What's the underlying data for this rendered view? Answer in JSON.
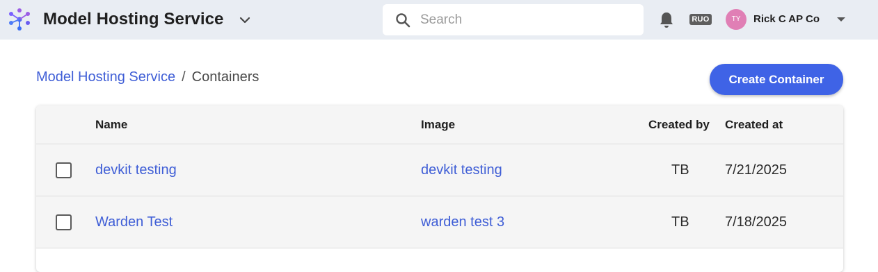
{
  "header": {
    "app_title": "Model Hosting Service",
    "search_placeholder": "Search",
    "badge": "RUO",
    "user_initials": "TY",
    "user_name": "Rick C AP Co"
  },
  "breadcrumb": {
    "parent": "Model Hosting Service",
    "separator": "/",
    "current": "Containers"
  },
  "actions": {
    "create_label": "Create Container"
  },
  "table": {
    "columns": {
      "name": "Name",
      "image": "Image",
      "created_by": "Created by",
      "created_at": "Created at"
    },
    "rows": [
      {
        "name": "devkit testing",
        "image": "devkit testing",
        "created_by": "TB",
        "created_at": "7/21/2025"
      },
      {
        "name": "Warden Test",
        "image": "warden test 3",
        "created_by": "TB",
        "created_at": "7/18/2025"
      }
    ]
  },
  "colors": {
    "accent": "#3f63e6",
    "link": "#3f5ed6",
    "topbar_bg": "#e9edf3",
    "avatar_bg": "#e07fb5"
  }
}
